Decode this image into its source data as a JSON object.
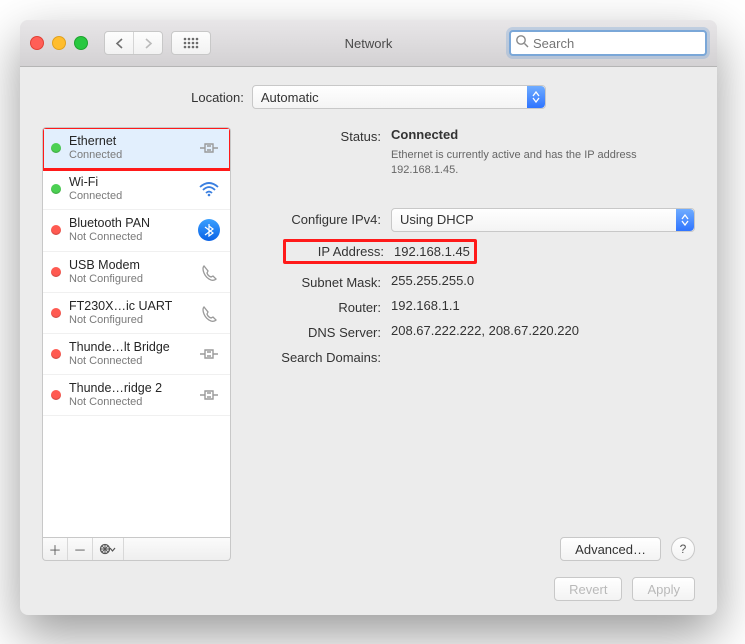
{
  "window": {
    "title": "Network"
  },
  "search": {
    "placeholder": "Search"
  },
  "location": {
    "label": "Location:",
    "value": "Automatic"
  },
  "sidebar": {
    "items": [
      {
        "name": "Ethernet",
        "status": "Connected",
        "color": "green",
        "icon": "ethernet"
      },
      {
        "name": "Wi-Fi",
        "status": "Connected",
        "color": "green",
        "icon": "wifi"
      },
      {
        "name": "Bluetooth PAN",
        "status": "Not Connected",
        "color": "red",
        "icon": "bluetooth"
      },
      {
        "name": "USB Modem",
        "status": "Not Configured",
        "color": "red",
        "icon": "phone"
      },
      {
        "name": "FT230X…ic UART",
        "status": "Not Configured",
        "color": "red",
        "icon": "phone"
      },
      {
        "name": "Thunde…lt Bridge",
        "status": "Not Connected",
        "color": "red",
        "icon": "ethernet"
      },
      {
        "name": "Thunde…ridge 2",
        "status": "Not Connected",
        "color": "red",
        "icon": "ethernet"
      }
    ]
  },
  "detail": {
    "status_label": "Status:",
    "status_value": "Connected",
    "status_desc": "Ethernet is currently active and has the IP address 192.168.1.45.",
    "config_label": "Configure IPv4:",
    "config_value": "Using DHCP",
    "ip_label": "IP Address:",
    "ip_value": "192.168.1.45",
    "mask_label": "Subnet Mask:",
    "mask_value": "255.255.255.0",
    "router_label": "Router:",
    "router_value": "192.168.1.1",
    "dns_label": "DNS Server:",
    "dns_value": "208.67.222.222, 208.67.220.220",
    "search_label": "Search Domains:",
    "search_value": ""
  },
  "buttons": {
    "advanced": "Advanced…",
    "revert": "Revert",
    "apply": "Apply",
    "help": "?"
  }
}
